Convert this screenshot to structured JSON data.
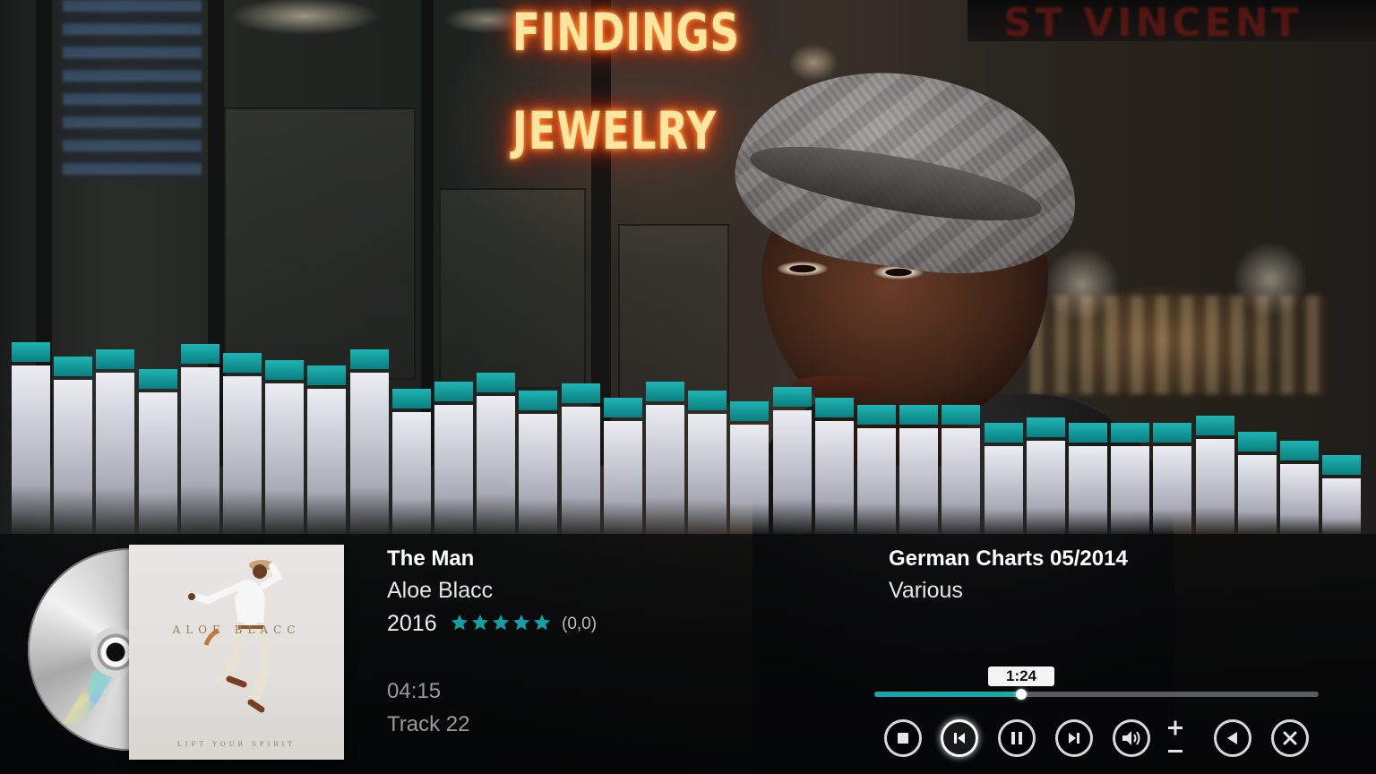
{
  "backdrop": {
    "sign_line1": "FINDINGS",
    "sign_line2": "JEWELRY",
    "top_sign": "ST VINCENT"
  },
  "visualizer": {
    "accent": "#14a0a2",
    "bar_color": "#d9dae2",
    "levels": [
      0.95,
      0.87,
      0.91,
      0.8,
      0.94,
      0.89,
      0.85,
      0.82,
      0.91,
      0.69,
      0.73,
      0.78,
      0.68,
      0.72,
      0.64,
      0.73,
      0.68,
      0.62,
      0.7,
      0.64,
      0.6,
      0.6,
      0.6,
      0.5,
      0.53,
      0.5,
      0.5,
      0.5,
      0.54,
      0.45,
      0.4,
      0.32
    ]
  },
  "now_playing": {
    "title": "The Man",
    "artist": "Aloe Blacc",
    "year": "2016",
    "rating_stars": 5,
    "rating_count": "(0,0)",
    "duration": "04:15",
    "track": "Track 22"
  },
  "album_art": {
    "cover_title": "ALOE BLACC",
    "cover_subtitle": "LIFT YOUR SPIRIT"
  },
  "album": {
    "name": "German Charts 05/2014",
    "artist": "Various"
  },
  "progress": {
    "elapsed": "1:24",
    "fraction": 0.33
  },
  "controls": [
    {
      "name": "stop-button",
      "icon": "stop-icon",
      "active": false
    },
    {
      "name": "previous-button",
      "icon": "skip-previous-icon",
      "active": true
    },
    {
      "name": "pause-button",
      "icon": "pause-icon",
      "active": false
    },
    {
      "name": "next-button",
      "icon": "skip-next-icon",
      "active": false
    },
    {
      "name": "volume-button",
      "icon": "volume-icon",
      "active": false
    },
    {
      "name": "volume-adjust",
      "icon": "plus-minus-icon",
      "active": false
    },
    {
      "name": "back-button",
      "icon": "back-triangle-icon",
      "active": false
    },
    {
      "name": "close-button",
      "icon": "close-icon",
      "active": false
    }
  ],
  "colors": {
    "accent": "#14a0a2",
    "panel_bg": "#07080a",
    "text_primary": "#ffffff",
    "text_secondary": "#9a9a9a"
  }
}
